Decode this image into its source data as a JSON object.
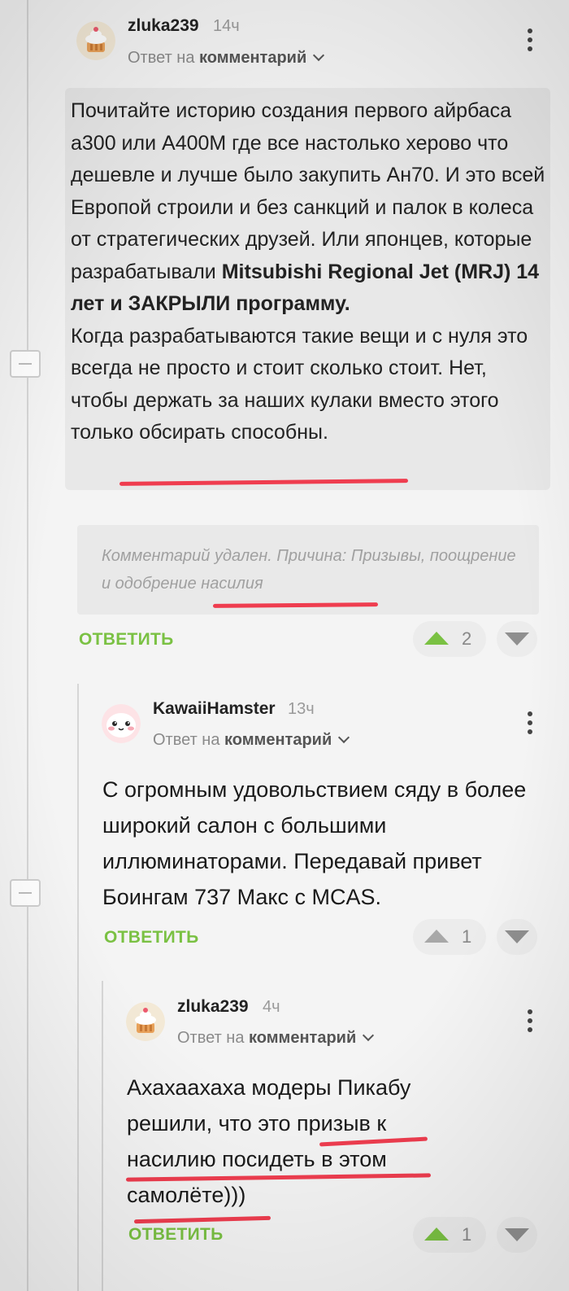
{
  "colors": {
    "accent_green": "#7ac143",
    "underline_red": "#ef3d4f",
    "background": "#f4f4f4"
  },
  "comment1": {
    "username": "zluka239",
    "time": "14ч",
    "reply_prefix": "Ответ на",
    "reply_target": "комментарий",
    "avatar_icon": "cupcake-avatar-icon",
    "menu_icon": "more-vertical-icon",
    "quote_plain_1": "Почитайте историю создания первого айрбаса а300 или А400М где все настолько херово что дешевле и лучше было закупить Ан70. И это всей Европой строили и без санкций и палок в колеса от стратегических друзей. Или японцев, которые разрабатывали ",
    "quote_bold": "Mitsubishi Regional Jet (MRJ) 14 лет и ЗАКРЫЛИ программу.",
    "quote_plain_2": "Когда разрабатываются такие вещи и с нуля это всегда не просто и стоит сколько стоит. Нет, чтобы держать за наших кулаки вместо этого только обсирать способны.",
    "deleted_text": "Комментарий удален. Причина: Призывы, поощрение и одобрение насилия",
    "reply_label": "ОТВЕТИТЬ",
    "votes": "2"
  },
  "comment2": {
    "username": "KawaiiHamster",
    "time": "13ч",
    "reply_prefix": "Ответ на",
    "reply_target": "комментарий",
    "avatar_icon": "hamster-avatar-icon",
    "menu_icon": "more-vertical-icon",
    "text": "С огромным удовольствием сяду в более широкий салон с большими иллюминаторами. Передавай привет Боингам 737 Макс с MCAS.",
    "reply_label": "ОТВЕТИТЬ",
    "votes": "1"
  },
  "comment3": {
    "username": "zluka239",
    "time": "4ч",
    "reply_prefix": "Ответ на",
    "reply_target": "комментарий",
    "avatar_icon": "cupcake-avatar-icon",
    "menu_icon": "more-vertical-icon",
    "text": "Ахахаахаха модеры Пикабу решили, что это призыв к насилию посидеть в этом самолёте)))",
    "reply_label": "ОТВЕТИТЬ",
    "votes": "1"
  }
}
